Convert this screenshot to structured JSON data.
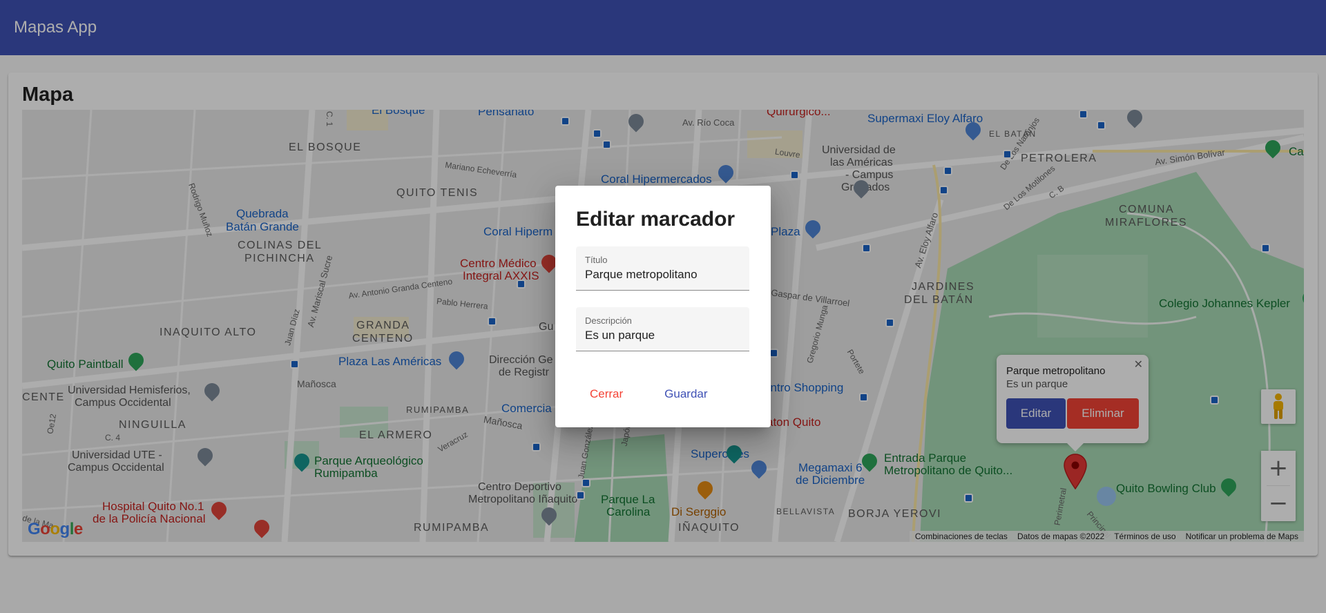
{
  "app": {
    "title": "Mapas App"
  },
  "card": {
    "title": "Mapa"
  },
  "map": {
    "labels": {
      "el_bosque": "EL BOSQUE",
      "quito_tenis": "QUITO TENIS",
      "colinas": "COLINAS DEL",
      "pichincha": "PICHINCHA",
      "quebrada1": "Quebrada",
      "quebrada2": "Batán Grande",
      "inaquito_alto": "INAQUITO ALTO",
      "granda1": "GRANDA",
      "granda2": "CENTENO",
      "ninguilla": "NINGUILLA",
      "el_armero": "EL ARMERO",
      "rumipamba1": "RUMIPAMBA",
      "rumipamba2": "RUMIPAMBA",
      "inaquito": "IÑAQUITO",
      "bellavista": "BELLAVISTA",
      "borja_yerovi": "BORJA YEROVI",
      "petrolera": "PETROLERA",
      "el_batan": "EL BATÁN",
      "comuna1": "COMUNA",
      "comuna2": "MIRAFLORES",
      "jardines1": "JARDINES",
      "jardines2": "DEL BATÁN",
      "cente": "CENTE",
      "coral_hiper": "Coral Hipermercados",
      "coral_hiper2": "Coral Hiperm",
      "supermaxi": "Supermaxi Eloy Alfaro",
      "udla1": "Universidad de",
      "udla2": "las Américas",
      "udla3": "- Campus",
      "udla4": "Granados",
      "plaza": "Plaza",
      "centro_medico1": "Centro Médico",
      "centro_medico2": "Integral AXXIS",
      "plaza_americas": "Plaza Las Américas",
      "direccion1": "Dirección Ge",
      "direccion2": "de Registr",
      "comercial": "Comercia",
      "quito_paintball": "Quito Paintball",
      "hemisferios1": "Universidad Hemisferios,",
      "hemisferios2": "Campus Occidental",
      "ute1": "Universidad UTE -",
      "ute2": "Campus Occidental",
      "parque_arq1": "Parque Arqueológico",
      "parque_arq2": "Rumipamba",
      "hospital1": "Hospital Quito No.1",
      "hospital2": "de la Policía Nacional",
      "centro_deportivo1": "Centro Deportivo",
      "centro_deportivo2": "Metropolitano Iñaquito",
      "parque_carolina1": "Parque La",
      "parque_carolina2": "Carolina",
      "di_serggio": "Di Serggio",
      "supercines": "Supercines",
      "megamaxi1": "Megamaxi 6",
      "megamaxi2": "de Diciembre",
      "entrada1": "Entrada Parque",
      "entrada2": "Metropolitano de Quito...",
      "bowling": "Quito Bowling Club",
      "kepler": "Colegio Johannes Kepler",
      "centro_shopping": "entro Shopping",
      "aton_quito": "aton Quito",
      "quirurgico": "Quirurgico...",
      "pensanato": "Pensanato",
      "el_bosque_top": "El Bosque",
      "cam": "Cam",
      "gu": "Gu",
      "av_rio_coca": "Av. Río Coca",
      "av_simon": "Av. Simón Bolívar",
      "mariano": "Mariano Echeverría",
      "av_granda": "Av. Antonio Granda Centeno",
      "pablo_herrera": "Pablo Herrera",
      "av_sucre": "Av. Mariscal Sucre",
      "mañosca1": "Mañosca",
      "mañosca2": "Mañosca",
      "eloy_alfaro": "Av. Eloy Alfaro",
      "gaspar": "Gaspar de Villarroel",
      "louvre": "Louvre",
      "rodrigo_munoz": "Rodrigo Muñoz",
      "juan_diaz": "Juan Díaz",
      "veracruz": "Veracruz",
      "oe12": "Oe12",
      "c4": "C. 4",
      "portete": "Portete",
      "gregorio": "Gregorio Munga",
      "naranjos": "De Los Naranjos",
      "motilones": "De Los Motilones",
      "cb": "C. B",
      "c1": "C. 1",
      "japon": "Japón",
      "juan_gonzalez": "Juan González",
      "perimetral": "Perimetral",
      "principal": "Principal",
      "de_la_ma": "de la Ma"
    },
    "google_logo": "Google",
    "footer": [
      "Combinaciones de teclas",
      "Datos de mapas ©2022",
      "Términos de uso",
      "Notificar un problema de Maps"
    ]
  },
  "info_window": {
    "title": "Parque metropolitano",
    "description": "Es un parque",
    "edit_label": "Editar",
    "delete_label": "Eliminar"
  },
  "dialog": {
    "title": "Editar marcador",
    "title_field": {
      "label": "Título",
      "value": "Parque metropolitano"
    },
    "description_field": {
      "label": "Descripción",
      "value": "Es un parque"
    },
    "close_label": "Cerrar",
    "save_label": "Guardar"
  },
  "colors": {
    "primary": "#3f51b5",
    "warn": "#f44336",
    "park": "#a8dab5"
  }
}
